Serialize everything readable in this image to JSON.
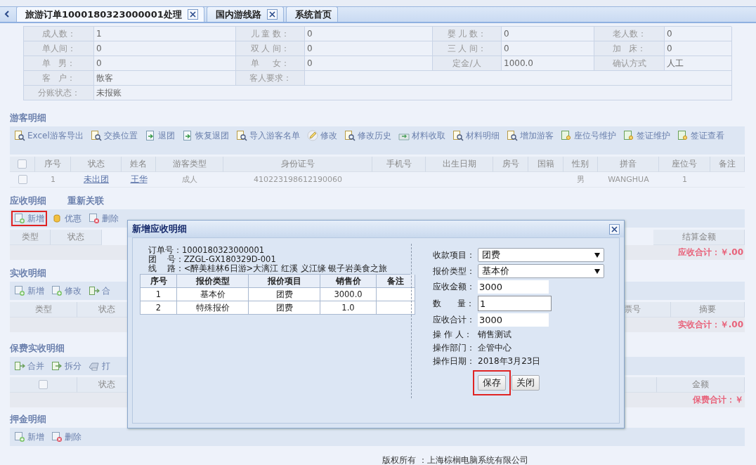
{
  "tabs": [
    {
      "label": "旅游订单1000180323000001处理",
      "selected": true,
      "closable": true
    },
    {
      "label": "国内游线路",
      "selected": false,
      "closable": true
    },
    {
      "label": "系统首页",
      "selected": false,
      "closable": false
    }
  ],
  "order_info": [
    [
      {
        "label": "成人数：",
        "value": "1"
      },
      {
        "label": "儿 童 数：",
        "value": "0"
      },
      {
        "label": "婴 儿 数：",
        "value": "0"
      },
      {
        "label": "老人数：",
        "value": "0"
      }
    ],
    [
      {
        "label": "单人间：",
        "value": "0"
      },
      {
        "label": "双 人 间：",
        "value": "0"
      },
      {
        "label": "三 人 间：",
        "value": "0"
      },
      {
        "label": "加   床：",
        "value": "0"
      }
    ],
    [
      {
        "label": "单   男：",
        "value": "0"
      },
      {
        "label": "单     女：",
        "value": "0"
      },
      {
        "label": "定金/人",
        "value": "1000.0"
      },
      {
        "label": "确认方式",
        "value": "人工"
      }
    ],
    [
      {
        "label": "客   户：",
        "value": "散客"
      },
      {
        "label": "客人要求："
      }
    ],
    [
      {
        "label": "分账状态：",
        "value": "未报账"
      }
    ]
  ],
  "guests": {
    "title": "游客明细",
    "toolbar": [
      {
        "kind": "find",
        "label": "Excel游客导出"
      },
      {
        "kind": "find",
        "label": "交换位置"
      },
      {
        "kind": "arrow",
        "label": "退团"
      },
      {
        "kind": "arrow",
        "label": "恢复退团"
      },
      {
        "kind": "find",
        "label": "导入游客名单"
      },
      {
        "kind": "pencil",
        "label": "修改"
      },
      {
        "kind": "find",
        "label": "修改历史"
      },
      {
        "kind": "receive",
        "label": "材料收取"
      },
      {
        "kind": "find",
        "label": "材料明细"
      },
      {
        "kind": "find",
        "label": "增加游客"
      },
      {
        "kind": "sheet",
        "label": "座位号维护"
      },
      {
        "kind": "sheet",
        "label": "签证维护"
      },
      {
        "kind": "sheet",
        "label": "签证查看"
      }
    ],
    "header_checked": false,
    "columns": [
      "序号",
      "状态",
      "姓名",
      "游客类型",
      "身份证号",
      "手机号",
      "出生日期",
      "房号",
      "国籍",
      "性别",
      "拼音",
      "座位号",
      "备注"
    ],
    "rows": [
      {
        "checked": false,
        "cells": [
          {
            "text": "1",
            "kind": "text"
          },
          {
            "text": "未出团",
            "kind": "link"
          },
          {
            "text": "王华",
            "kind": "link"
          },
          {
            "text": "成人",
            "kind": "text"
          },
          {
            "text": "410223198612190060",
            "kind": "text"
          },
          null,
          null,
          null,
          null,
          {
            "text": "男",
            "kind": "text"
          },
          {
            "text": "WANGHUA",
            "kind": "text"
          },
          {
            "text": "1",
            "kind": "text"
          },
          null
        ]
      }
    ]
  },
  "receivable": {
    "title": "应收明细",
    "relink": "重新关联",
    "toolbar": [
      {
        "kind": "add",
        "label": "新增",
        "highlighted": true
      },
      {
        "kind": "coins",
        "label": "优惠",
        "highlighted": false
      },
      {
        "kind": "delete",
        "label": "删除",
        "highlighted": false
      }
    ],
    "columns": [
      "类型",
      "状态"
    ],
    "columns_right": [
      "结算金额"
    ],
    "total": "应收合计：￥.00"
  },
  "paid": {
    "title": "实收明细",
    "toolbar": [
      {
        "kind": "add",
        "label": "新增"
      },
      {
        "kind": "add",
        "label": "修改"
      },
      {
        "kind": "merge",
        "label": "合"
      }
    ],
    "columns": [
      "类型",
      "状态"
    ],
    "columns_right": [
      "票号",
      "摘要"
    ],
    "total": "实收合计：￥.00"
  },
  "premium": {
    "title": "保费实收明细",
    "toolbar": [
      {
        "kind": "merge",
        "label": "合并"
      },
      {
        "kind": "split",
        "label": "拆分"
      },
      {
        "kind": "print",
        "label": "打"
      }
    ],
    "header_checked": false,
    "columns": [
      "状态"
    ],
    "columns_right": [
      "金额"
    ],
    "total": "保费合计：￥"
  },
  "deposit": {
    "title": "押金明细",
    "toolbar": [
      {
        "kind": "add",
        "label": "新增"
      },
      {
        "kind": "delete",
        "label": "删除"
      }
    ]
  },
  "footer": "版权所有 ：上海棕榈电脑系统有限公司",
  "dialog": {
    "title": "新增应收明细",
    "info": [
      {
        "label": "订单号：",
        "value": "1000180323000001"
      },
      {
        "label": "团    号：",
        "value": "ZZGL-GX180329D-001"
      },
      {
        "label": "线    路：",
        "value": "<醉美桂林6日游>大漓江 红溪 义江缘 银子岩美食之旅"
      }
    ],
    "price_columns": [
      "序号",
      "报价类型",
      "报价项目",
      "销售价",
      "备注"
    ],
    "price_rows": [
      [
        "1",
        "基本价",
        "团费",
        "3000.0",
        null
      ],
      [
        "2",
        "特殊报价",
        "团费",
        "1.0",
        null
      ]
    ],
    "fields": [
      {
        "kind": "select",
        "label": "收款项目：",
        "value": "团费"
      },
      {
        "kind": "select",
        "label": "报价类型：",
        "value": "基本价"
      },
      {
        "kind": "input",
        "label": "应收金额：",
        "value": "3000",
        "bordered": false
      },
      {
        "kind": "input",
        "label": "数      量：",
        "value": "1",
        "bordered": true
      },
      {
        "kind": "input",
        "label": "应收合计：",
        "value": "3000",
        "bordered": false
      },
      {
        "kind": "text",
        "label": "操 作 人：",
        "value": "销售测试"
      },
      {
        "kind": "text",
        "label": "操作部门：",
        "value": "企管中心"
      },
      {
        "kind": "text",
        "label": "操作日期：",
        "value": "2018年3月23日"
      }
    ],
    "buttons": [
      {
        "label": "保存",
        "highlighted": true
      },
      {
        "label": "关闭",
        "highlighted": false
      }
    ]
  }
}
